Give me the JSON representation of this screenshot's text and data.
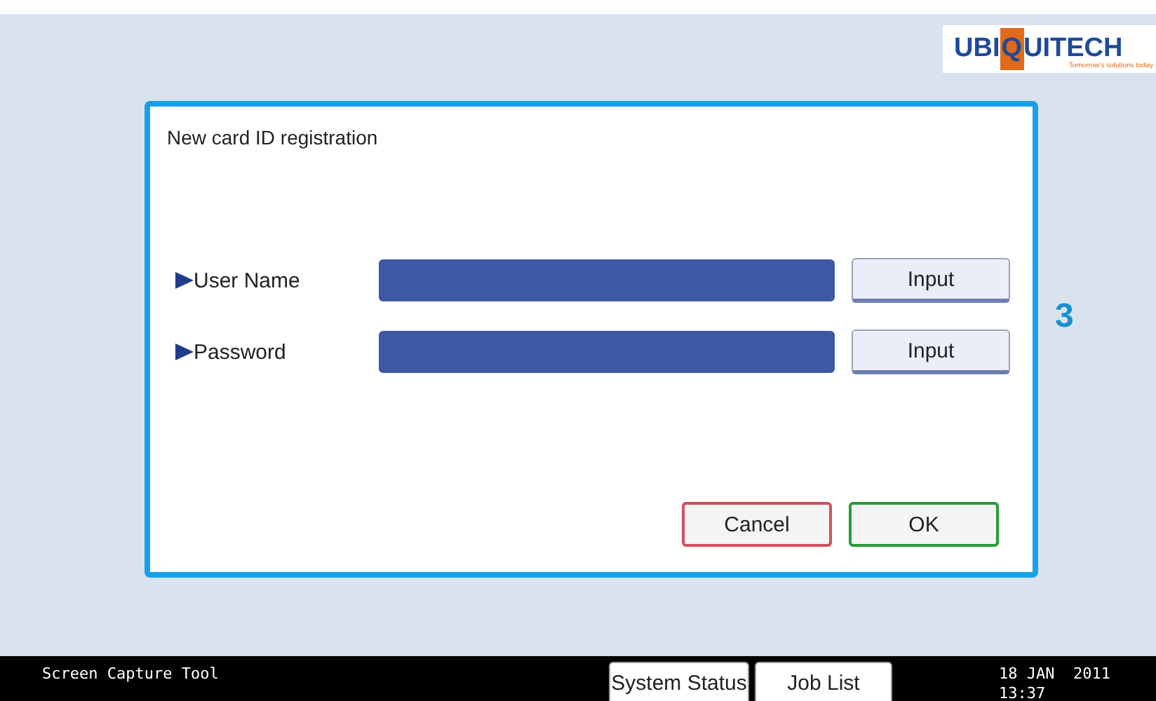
{
  "logo": {
    "before": "UBI",
    "highlight": "Q",
    "after": "UITECH",
    "tagline": "Tomorrow's solutions today"
  },
  "step_number": "3",
  "dialog": {
    "title": "New card ID registration",
    "fields": [
      {
        "label": "User Name",
        "button": "Input"
      },
      {
        "label": "Password",
        "button": "Input"
      }
    ],
    "buttons": [
      {
        "label": "Cancel",
        "kind": "cancel"
      },
      {
        "label": "OK",
        "kind": "ok"
      }
    ]
  },
  "status_bar": {
    "app": "Screen Capture Tool",
    "buttons": [
      "System Status",
      "Job List"
    ],
    "date": "18 JAN  2011",
    "time": "13:37"
  }
}
